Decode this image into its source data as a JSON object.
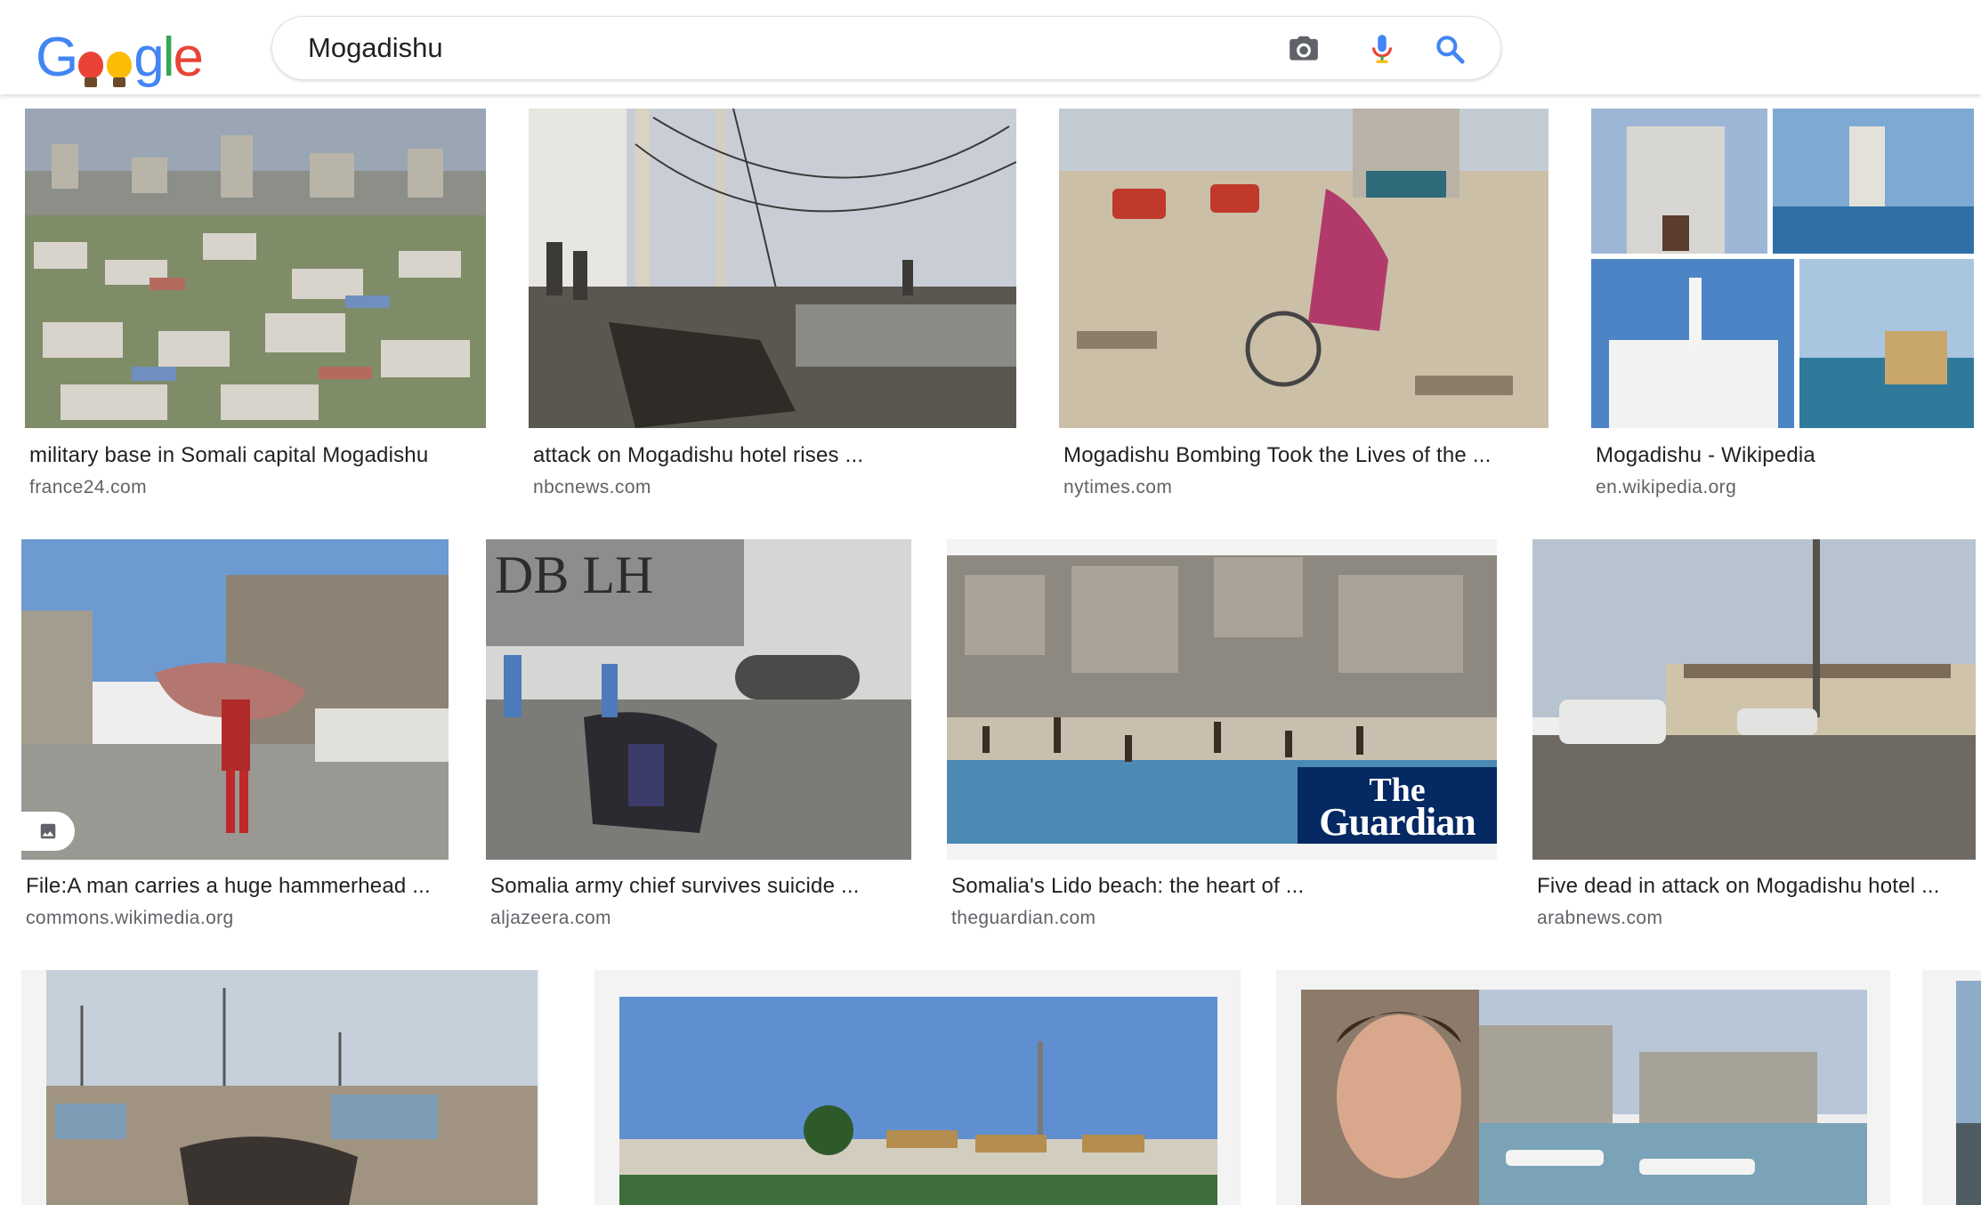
{
  "logo": {
    "letters": [
      "G",
      "o",
      "o",
      "g",
      "l",
      "e"
    ],
    "alt": "Google"
  },
  "search": {
    "value": "Mogadishu",
    "icons": [
      "camera-icon",
      "mic-icon",
      "search-icon"
    ]
  },
  "results": [
    {
      "title": "military base in Somali capital Mogadishu",
      "source": "france24.com",
      "thumb": "city-aerial"
    },
    {
      "title": "attack on Mogadishu hotel rises ...",
      "source": "nbcnews.com",
      "thumb": "wreckage-wires"
    },
    {
      "title": "Mogadishu Bombing Took the Lives of the ...",
      "source": "nytimes.com",
      "thumb": "woman-wheelchair"
    },
    {
      "title": "Mogadishu - Wikipedia",
      "source": "en.wikipedia.org",
      "thumb": "wiki-collage"
    },
    {
      "title": "File:A man carries a huge hammerhead ...",
      "source": "commons.wikimedia.org",
      "thumb": "man-hammerhead"
    },
    {
      "title": "Somalia army chief survives suicide ...",
      "source": "aljazeera.com",
      "thumb": "blast-debris"
    },
    {
      "title": "Somalia's Lido beach: the heart of ...",
      "source": "theguardian.com",
      "thumb": "lido-beach"
    },
    {
      "title": "Five dead in attack on Mogadishu hotel ...",
      "source": "arabnews.com",
      "thumb": "hotel-street"
    },
    {
      "title": "",
      "source": "",
      "thumb": "market-wreck"
    },
    {
      "title": "",
      "source": "",
      "thumb": "skyline-tower"
    },
    {
      "title": "",
      "source": "",
      "thumb": "selfie-ruins"
    }
  ],
  "guardian_watermark": [
    "The",
    "Guardian"
  ],
  "colors": {
    "blue": "#4285f4",
    "red": "#ea4335",
    "yellow": "#fbbc05",
    "green": "#34a853",
    "guardian": "#052962"
  }
}
